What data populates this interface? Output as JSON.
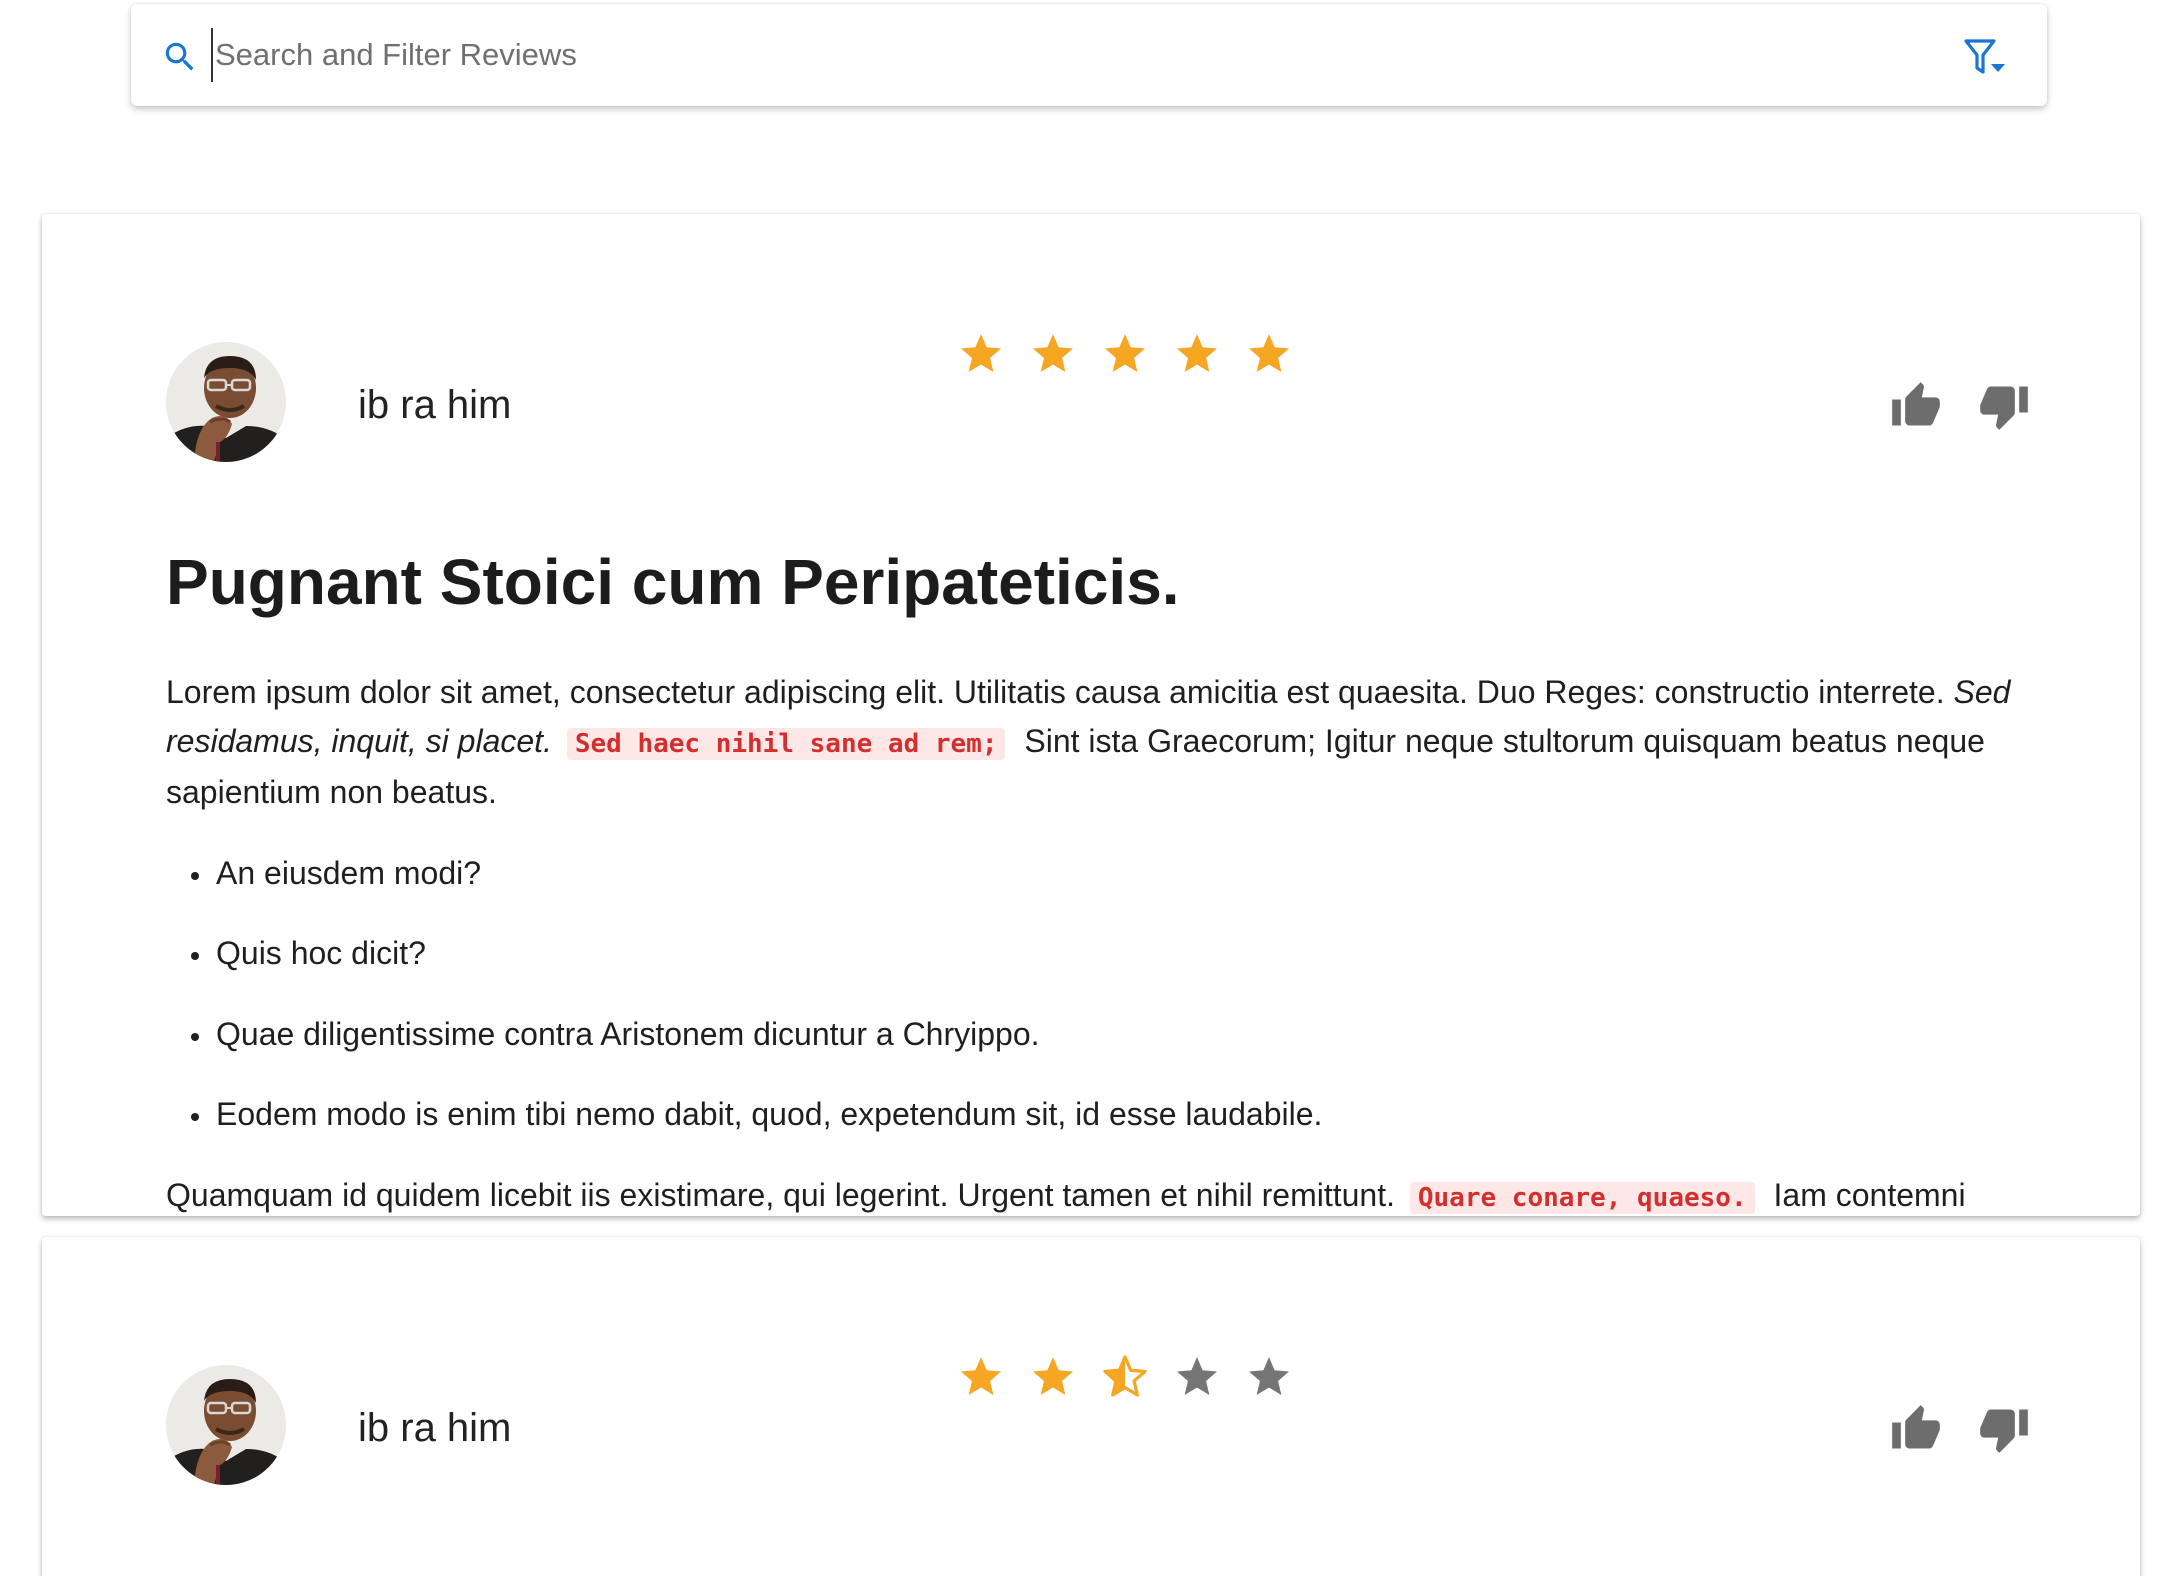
{
  "search": {
    "placeholder": "Search and Filter Reviews",
    "value": "",
    "icon": "search-icon",
    "filter_icon": "filter-menu-icon",
    "accent_color": "#1976d2"
  },
  "colors": {
    "star_filled": "#f5a623",
    "star_empty": "#757575",
    "action_icon": "#6d6d6d",
    "code_text": "#d32f2f",
    "code_background": "#fde7e7"
  },
  "reviews": [
    {
      "author": "ib ra him",
      "rating": 5,
      "max_rating": 5,
      "title": "Pugnant Stoici cum Peripateticis.",
      "paragraph_1": {
        "text_a": "Lorem ipsum dolor sit amet, consectetur adipiscing elit. Utilitatis causa amicitia est quaesita. Duo Reges: constructio interrete. ",
        "italic": "Sed residamus, inquit, si placet.",
        "code": "Sed haec nihil sane ad rem;",
        "text_b": "Sint ista Graecorum; Igitur neque stultorum quisquam beatus neque sapientium non beatus."
      },
      "list_items": [
        "An eiusdem modi?",
        "Quis hoc dicit?",
        "Quae diligentissime contra Aristonem dicuntur a Chryippo.",
        "Eodem modo is enim tibi nemo dabit, quod, expetendum sit, id esse laudabile."
      ],
      "paragraph_2": {
        "text_a": "Quamquam id quidem licebit iis existimare, qui legerint. Urgent tamen et nihil remittunt.",
        "code": "Quare conare, quaeso.",
        "text_b": "Iam contemni"
      },
      "actions": {
        "like_icon": "thumb-up-icon",
        "dislike_icon": "thumb-down-icon"
      }
    },
    {
      "author": "ib ra him",
      "rating": 2.5,
      "max_rating": 5,
      "actions": {
        "like_icon": "thumb-up-icon",
        "dislike_icon": "thumb-down-icon"
      }
    }
  ]
}
